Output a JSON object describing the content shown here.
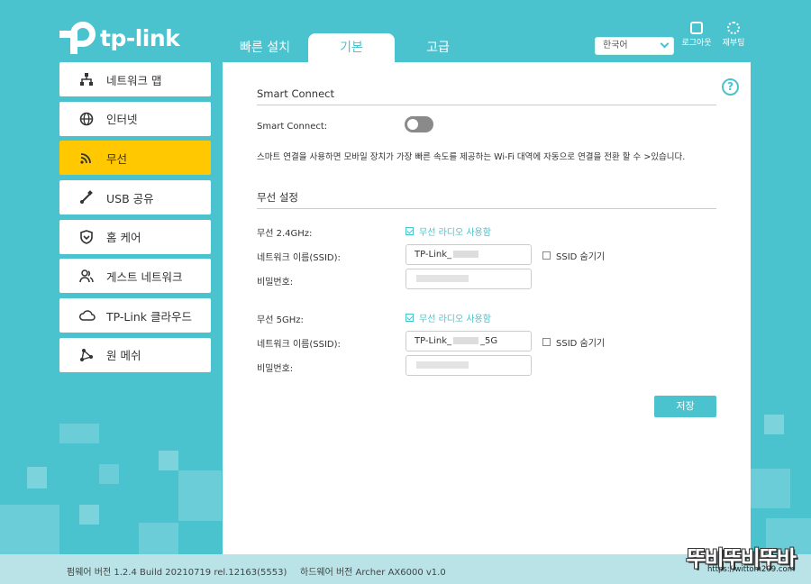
{
  "brand": {
    "logo_text": "tp-link"
  },
  "tabs": [
    {
      "label": "빠른 설치"
    },
    {
      "label": "기본",
      "active": true
    },
    {
      "label": "고급"
    }
  ],
  "header": {
    "language": "한국어",
    "logout_label": "로그아웃",
    "reboot_label": "재부팅"
  },
  "sidebar": {
    "items": [
      {
        "label": "네트워크 맵",
        "icon": "network-map-icon"
      },
      {
        "label": "인터넷",
        "icon": "globe-icon"
      },
      {
        "label": "무선",
        "icon": "wifi-icon",
        "active": true
      },
      {
        "label": "USB 공유",
        "icon": "usb-icon"
      },
      {
        "label": "홈 케어",
        "icon": "shield-icon"
      },
      {
        "label": "게스트 네트워크",
        "icon": "guest-users-icon"
      },
      {
        "label": "TP-Link 클라우드",
        "icon": "cloud-icon"
      },
      {
        "label": "원 메쉬",
        "icon": "mesh-icon"
      }
    ]
  },
  "smart_connect": {
    "section_title": "Smart Connect",
    "label": "Smart Connect:",
    "enabled": false,
    "description": "스마트 연결을 사용하면 모바일 장치가 가장 빠른 속도를 제공하는 Wi-Fi 대역에 자동으로 연결을 전환 할 수 >있습니다."
  },
  "wireless": {
    "section_title": "무선 설정",
    "band24": {
      "label": "무선 2.4GHz:",
      "enable_label": "무선 라디오 사용함",
      "enabled": true,
      "ssid_label": "네트워크 이름(SSID):",
      "ssid_prefix": "TP-Link_",
      "ssid_suffix": "",
      "hide_label": "SSID 숨기기",
      "hide": false,
      "password_label": "비밀번호:"
    },
    "band5": {
      "label": "무선 5GHz:",
      "enable_label": "무선 라디오 사용함",
      "enabled": true,
      "ssid_label": "네트워크 이름(SSID):",
      "ssid_prefix": "TP-Link_",
      "ssid_suffix": "_5G",
      "hide_label": "SSID 숨기기",
      "hide": false,
      "password_label": "비밀번호:"
    },
    "save_label": "저장"
  },
  "footer": {
    "firmware": "펌웨어 버전 1.2.4 Build 20210719 rel.12163(5553)",
    "hardware": "하드웨어 버전 Archer AX6000 v1.0"
  },
  "watermark": {
    "text": "뚜비뚜비뚜바",
    "url": "https://wittom209.com"
  },
  "colors": {
    "accent": "#4ac3cf",
    "active_nav": "#ffc800",
    "toggle_off": "#8a8a8a"
  }
}
